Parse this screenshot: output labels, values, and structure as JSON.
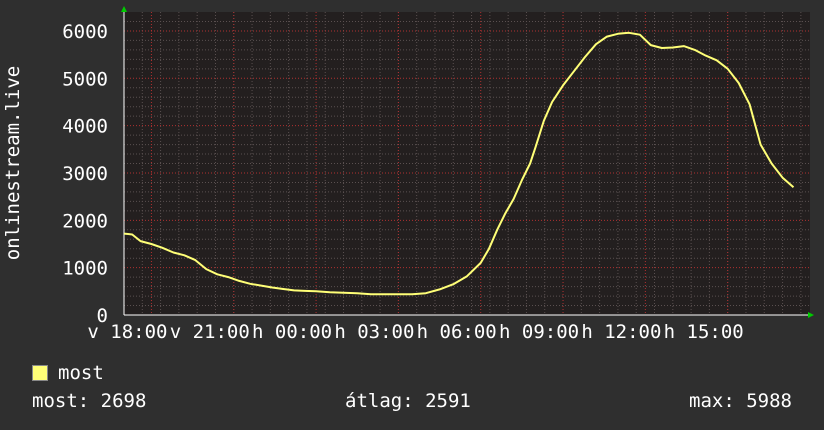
{
  "chart_data": {
    "type": "line",
    "ylabel": "onlinestream.live",
    "ylim": [
      0,
      6400
    ],
    "yticks": [
      0,
      1000,
      2000,
      3000,
      4000,
      5000,
      6000
    ],
    "x_range_hours": [
      17,
      25
    ],
    "x_ticks": [
      {
        "t": 18,
        "label": "v 18:00"
      },
      {
        "t": 21,
        "label": "v 21:00"
      },
      {
        "t": 24,
        "label": "h 00:00"
      },
      {
        "t": 27,
        "label": "h 03:00"
      },
      {
        "t": 30,
        "label": "h 06:00"
      },
      {
        "t": 33,
        "label": "h 09:00"
      },
      {
        "t": 36,
        "label": "h 12:00"
      },
      {
        "t": 39,
        "label": "h 15:00"
      }
    ],
    "grid": true,
    "series": [
      {
        "name": "most",
        "color": "#ffff77",
        "points": [
          [
            17.0,
            1720
          ],
          [
            17.3,
            1700
          ],
          [
            17.6,
            1560
          ],
          [
            18.0,
            1500
          ],
          [
            18.4,
            1420
          ],
          [
            18.8,
            1320
          ],
          [
            19.2,
            1260
          ],
          [
            19.6,
            1160
          ],
          [
            20.0,
            970
          ],
          [
            20.4,
            860
          ],
          [
            20.8,
            800
          ],
          [
            21.2,
            720
          ],
          [
            21.6,
            660
          ],
          [
            22.0,
            620
          ],
          [
            22.4,
            580
          ],
          [
            22.8,
            550
          ],
          [
            23.2,
            520
          ],
          [
            23.6,
            510
          ],
          [
            24.0,
            500
          ],
          [
            24.5,
            480
          ],
          [
            25.0,
            470
          ],
          [
            25.5,
            460
          ],
          [
            26.0,
            440
          ],
          [
            26.5,
            440
          ],
          [
            27.0,
            440
          ],
          [
            27.5,
            440
          ],
          [
            28.0,
            460
          ],
          [
            28.5,
            540
          ],
          [
            29.0,
            650
          ],
          [
            29.5,
            820
          ],
          [
            30.0,
            1100
          ],
          [
            30.3,
            1400
          ],
          [
            30.6,
            1800
          ],
          [
            30.9,
            2150
          ],
          [
            31.2,
            2450
          ],
          [
            31.5,
            2850
          ],
          [
            31.8,
            3200
          ],
          [
            32.0,
            3550
          ],
          [
            32.3,
            4100
          ],
          [
            32.6,
            4500
          ],
          [
            33.0,
            4850
          ],
          [
            33.4,
            5150
          ],
          [
            33.8,
            5450
          ],
          [
            34.2,
            5720
          ],
          [
            34.6,
            5880
          ],
          [
            35.0,
            5940
          ],
          [
            35.4,
            5960
          ],
          [
            35.8,
            5920
          ],
          [
            36.2,
            5700
          ],
          [
            36.6,
            5640
          ],
          [
            37.0,
            5650
          ],
          [
            37.4,
            5680
          ],
          [
            37.8,
            5600
          ],
          [
            38.2,
            5480
          ],
          [
            38.6,
            5380
          ],
          [
            39.0,
            5200
          ],
          [
            39.4,
            4900
          ],
          [
            39.8,
            4450
          ],
          [
            40.2,
            3600
          ],
          [
            40.6,
            3200
          ],
          [
            41.0,
            2900
          ],
          [
            41.4,
            2698
          ]
        ]
      }
    ]
  },
  "legend": {
    "label": "most",
    "color": "#ffff77"
  },
  "stats": {
    "current": "most: 2698",
    "average": "átlag: 2591",
    "maximum": "max: 5988"
  }
}
